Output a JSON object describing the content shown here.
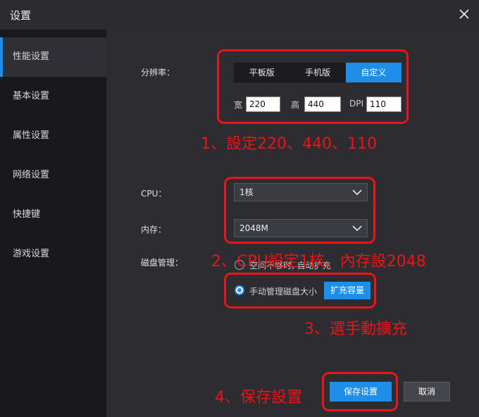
{
  "window": {
    "title": "设置"
  },
  "sidebar": {
    "items": [
      {
        "label": "性能设置"
      },
      {
        "label": "基本设置"
      },
      {
        "label": "属性设置"
      },
      {
        "label": "网络设置"
      },
      {
        "label": "快捷键"
      },
      {
        "label": "游戏设置"
      }
    ],
    "active_index": 0
  },
  "resolution": {
    "label": "分辨率：",
    "options": [
      "平板版",
      "手机版",
      "自定义"
    ],
    "selected": "自定义",
    "width_label": "宽",
    "width_value": "220",
    "height_label": "高",
    "height_value": "440",
    "dpi_label": "DPI",
    "dpi_value": "110"
  },
  "cpu": {
    "label": "CPU：",
    "value": "1核"
  },
  "memory": {
    "label": "内存：",
    "value": "2048M"
  },
  "disk": {
    "label": "磁盘管理：",
    "option_auto": "空间不够时, 自动扩充",
    "option_manual": "手动管理磁盘大小",
    "selected": "手动管理磁盘大小",
    "expand_button": "扩充容量"
  },
  "footer": {
    "save_button": "保存设置",
    "cancel_button": "取消"
  },
  "annotations": {
    "step1": "1、設定220、440、110",
    "step2": "2、CPU設定1核、內存設2048",
    "step3": "3、選手動擴充",
    "step4": "4、保存設置"
  },
  "colors": {
    "accent": "#1f8ee8",
    "annotation": "#e8151a"
  }
}
